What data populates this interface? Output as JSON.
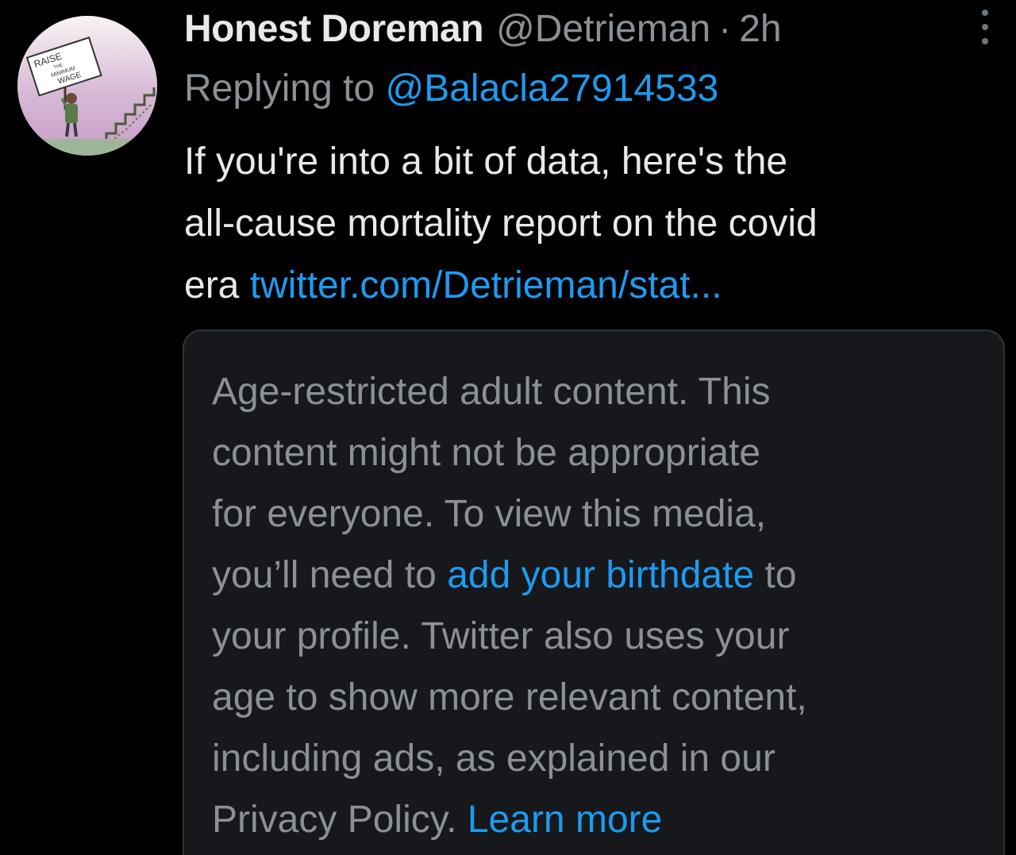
{
  "tweet": {
    "author_name": "Honest Doreman",
    "author_handle": "@Detrieman",
    "separator": "·",
    "time": "2h",
    "replying_prefix": "Replying to",
    "replying_to": "@Balacla27914533",
    "body": {
      "line1": "If you're into a bit of data, here's the",
      "line2": "all-cause mortality report on the covid",
      "line3_prefix": "era",
      "link": "twitter.com/Detrieman/stat..."
    },
    "more_icon": "more-vertical-icon"
  },
  "avatar": {
    "sign_text": [
      "RAISE",
      "THE",
      "MINIMUM",
      "WAGE"
    ]
  },
  "restricted_card": {
    "line1": "Age-restricted adult content. This",
    "line2": "content might not be appropriate",
    "line3": "for everyone. To view this media,",
    "line4_prefix": "you’ll need to",
    "birthdate_link": "add your birthdate",
    "line4_suffix": "to",
    "line5": "your profile. Twitter also uses your",
    "line6": "age to show more relevant content,",
    "line7": "including ads, as explained in our",
    "line8_prefix": "Privacy Policy.",
    "learn_more_link": "Learn more"
  },
  "colors": {
    "background": "#000000",
    "text_primary": "#e7e9ea",
    "text_secondary": "#8b9096",
    "link": "#1d9bf0",
    "card_bg": "#16181c",
    "card_border": "#2f3336"
  }
}
